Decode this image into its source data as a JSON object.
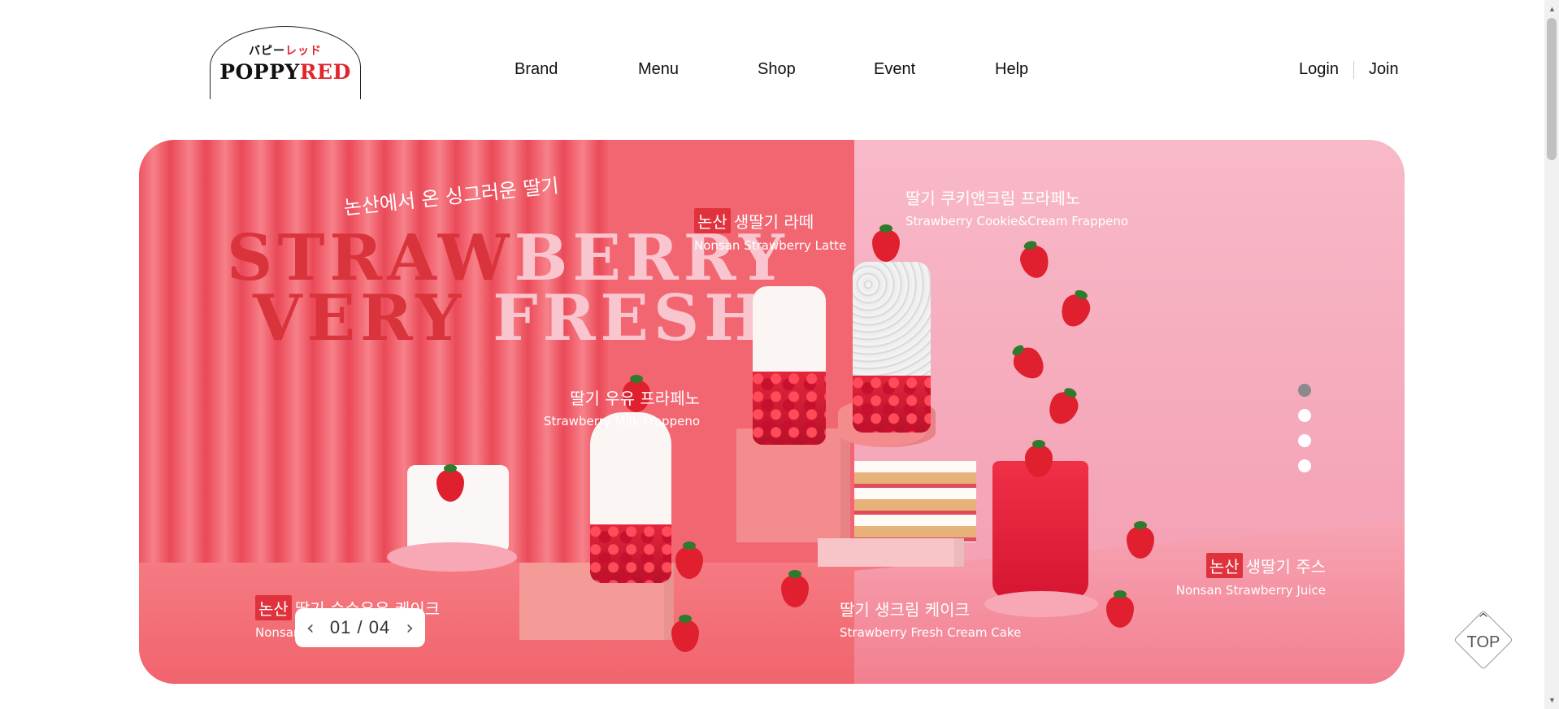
{
  "brand": {
    "kana_part1": "バピー",
    "kana_part2": "レッド",
    "word_part1": "POPPY",
    "word_part2": "RED"
  },
  "nav": {
    "items": [
      "Brand",
      "Menu",
      "Shop",
      "Event",
      "Help"
    ]
  },
  "auth": {
    "login": "Login",
    "join": "Join"
  },
  "hero": {
    "tagline": "논산에서 온 싱그러운 딸기",
    "headline_line1_red": "STRAW",
    "headline_line1_pink": "BERRY",
    "headline_line2_red": "VERY",
    "headline_line2_pink": "FRESH",
    "products": {
      "latte": {
        "tag": "논산",
        "ko": "생딸기 라떼",
        "en": "Nonsan Strawberry Latte"
      },
      "cookie": {
        "ko": "딸기 쿠키앤크림 프라페노",
        "en": "Strawberry Cookie&Cream Frappeno"
      },
      "milk": {
        "ko": "딸기 우유 프라페노",
        "en": "Strawberry Milk Frappeno"
      },
      "cake_left": {
        "tag": "논산",
        "ko": "딸기 순수우유 케이크",
        "en": "Nonsan Strawberry Cake"
      },
      "fresh_cake": {
        "ko": "딸기 생크림 케이크",
        "en": "Strawberry Fresh Cream Cake"
      },
      "juice": {
        "tag": "논산",
        "ko": "생딸기 주스",
        "en": "Nonsan Strawberry Juice"
      }
    }
  },
  "slider": {
    "current": "01",
    "separator": "/",
    "total": "04",
    "prev_icon": "‹",
    "next_icon": "›",
    "active_dot": 0,
    "dot_count": 4
  },
  "top_button": {
    "label": "TOP",
    "caret": "^"
  },
  "scrollbar": {
    "up": "▲",
    "down": "▼"
  }
}
